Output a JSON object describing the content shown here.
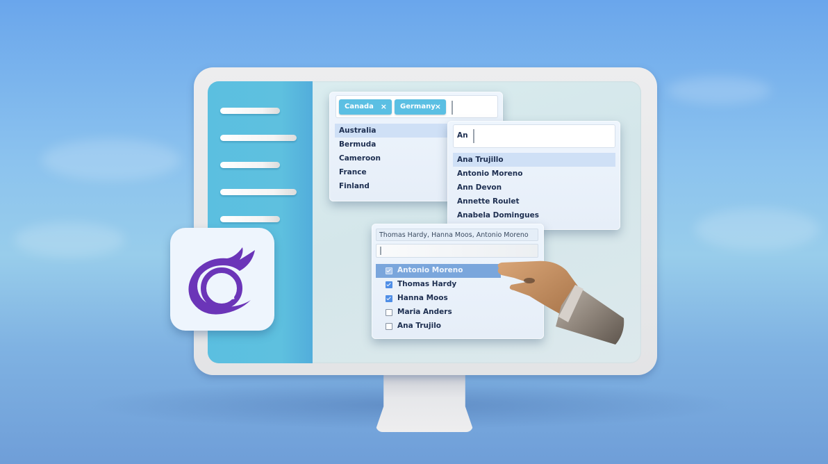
{
  "brand": {
    "logo_icon": "blazor-flame-at-icon",
    "logo_color": "#6b35b8",
    "accent_color": "#5bbfe3"
  },
  "sidebar": {
    "items": [
      {
        "label": ""
      },
      {
        "label": ""
      },
      {
        "label": ""
      },
      {
        "label": ""
      },
      {
        "label": ""
      }
    ]
  },
  "multiselect_countries": {
    "chips": [
      {
        "label": "Canada",
        "remove_icon": "×"
      },
      {
        "label": "Germany",
        "remove_icon": "×"
      }
    ],
    "input_value": "",
    "options": [
      {
        "label": "Australia",
        "highlighted": true
      },
      {
        "label": "Bermuda",
        "highlighted": false
      },
      {
        "label": "Cameroon",
        "highlighted": false
      },
      {
        "label": "France",
        "highlighted": false
      },
      {
        "label": "Finland",
        "highlighted": false
      }
    ]
  },
  "autocomplete_names": {
    "input_value": "An",
    "options": [
      {
        "label": "Ana Trujillo",
        "highlighted": true
      },
      {
        "label": "Antonio Moreno",
        "highlighted": false
      },
      {
        "label": "Ann Devon",
        "highlighted": false
      },
      {
        "label": "Annette Roulet",
        "highlighted": false
      },
      {
        "label": "Anabela Domingues",
        "highlighted": false
      }
    ]
  },
  "checkbox_multiselect": {
    "summary_value": "Thomas Hardy, Hanna Moos, Antonio Moreno",
    "filter_value": "",
    "options": [
      {
        "label": "Antonio Moreno",
        "checked": true,
        "hovered": true
      },
      {
        "label": "Thomas Hardy",
        "checked": true,
        "hovered": false
      },
      {
        "label": "Hanna Moos",
        "checked": true,
        "hovered": false
      },
      {
        "label": "Maria Anders",
        "checked": false,
        "hovered": false
      },
      {
        "label": "Ana Trujilo",
        "checked": false,
        "hovered": false
      }
    ]
  }
}
